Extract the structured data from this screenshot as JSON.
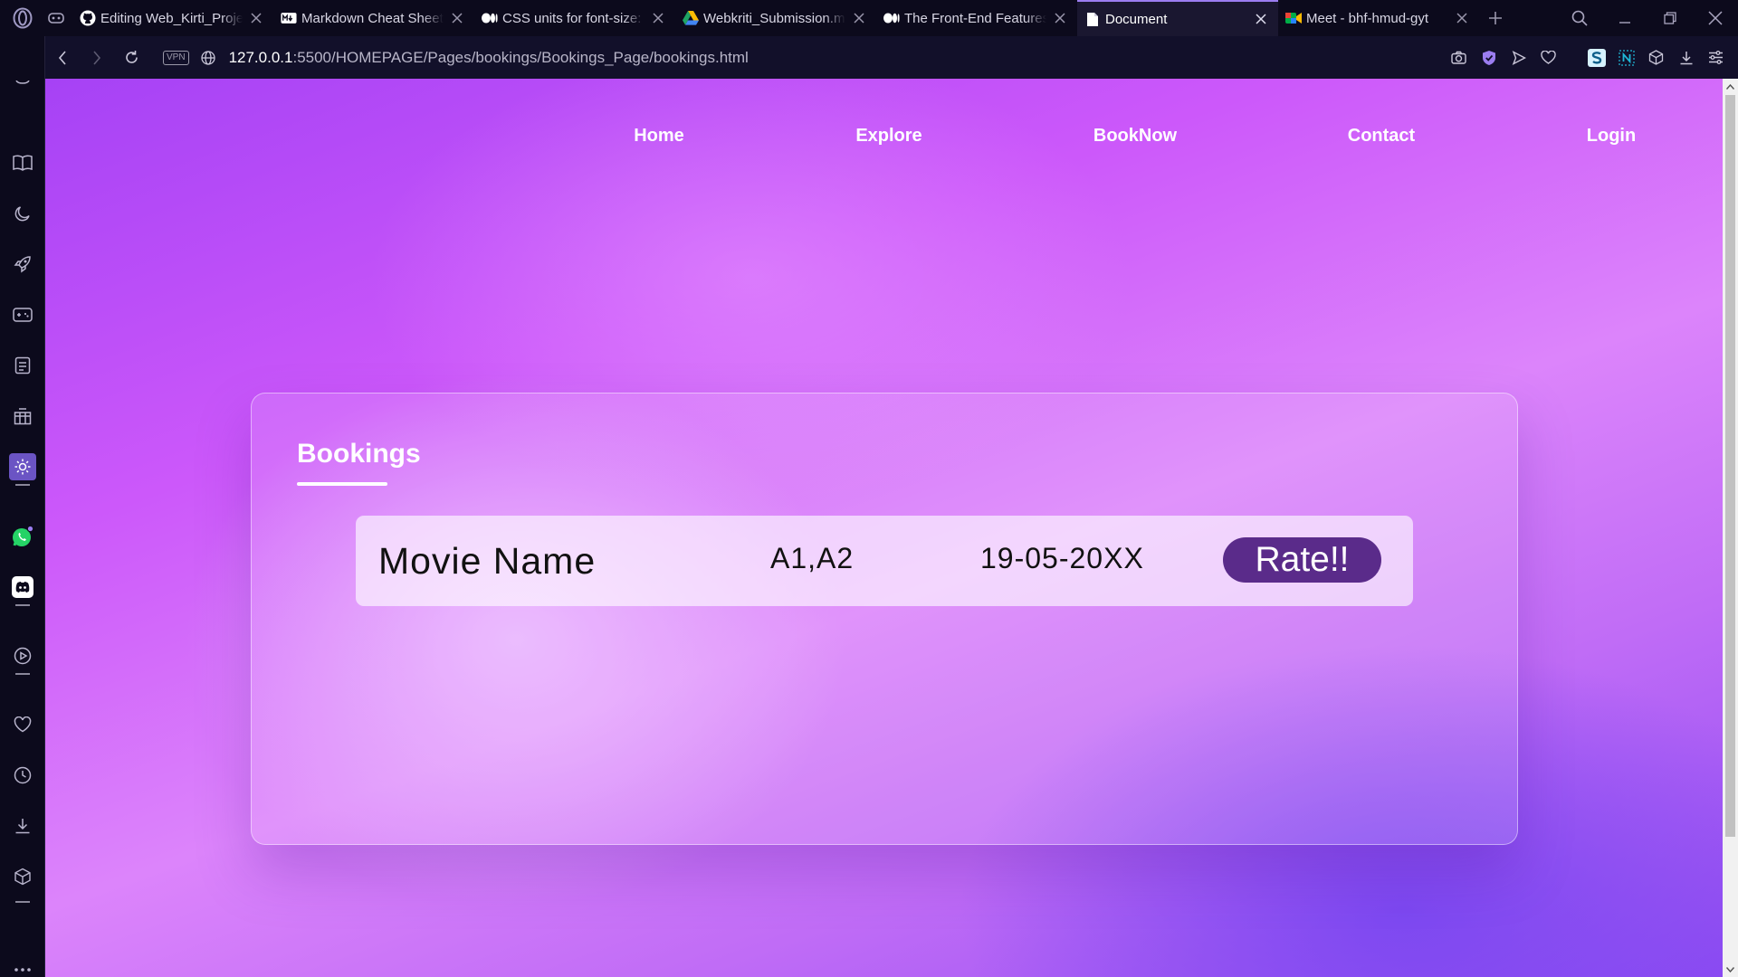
{
  "browser": {
    "tabs": [
      {
        "title": "Editing Web_Kirti_Proje",
        "favicon": "github-icon",
        "active": false
      },
      {
        "title": "Markdown Cheat Sheet",
        "favicon": "markdown-icon",
        "active": false
      },
      {
        "title": "CSS units for font-size:",
        "favicon": "medium-icon",
        "active": false
      },
      {
        "title": "Webkriti_Submission.m",
        "favicon": "google-drive-icon",
        "active": false
      },
      {
        "title": "The Front-End Features",
        "favicon": "medium-icon",
        "active": false
      },
      {
        "title": "Document",
        "favicon": "document-icon",
        "active": true
      },
      {
        "title": "Meet - bhf-hmud-gyt",
        "favicon": "google-meet-icon",
        "active": false
      }
    ],
    "address": {
      "host": "127.0.0.1",
      "path": ":5500/HOMEPAGE/Pages/bookings/Bookings_Page/bookings.html",
      "vpn_label": "VPN"
    },
    "accent_color": "#9b7df0"
  },
  "site": {
    "nav": {
      "home": "Home",
      "explore": "Explore",
      "booknow": "BookNow",
      "contact": "Contact",
      "login": "Login"
    },
    "bookings": {
      "title": "Bookings",
      "rows": [
        {
          "movie": "Movie Name",
          "seats": "A1,A2",
          "date": "19-05-20XX",
          "action": "Rate!!"
        }
      ]
    },
    "colors": {
      "rate_button": "#5a2b8a",
      "background_primary": "#cc58fa",
      "background_dark": "#8e4bf2"
    }
  }
}
